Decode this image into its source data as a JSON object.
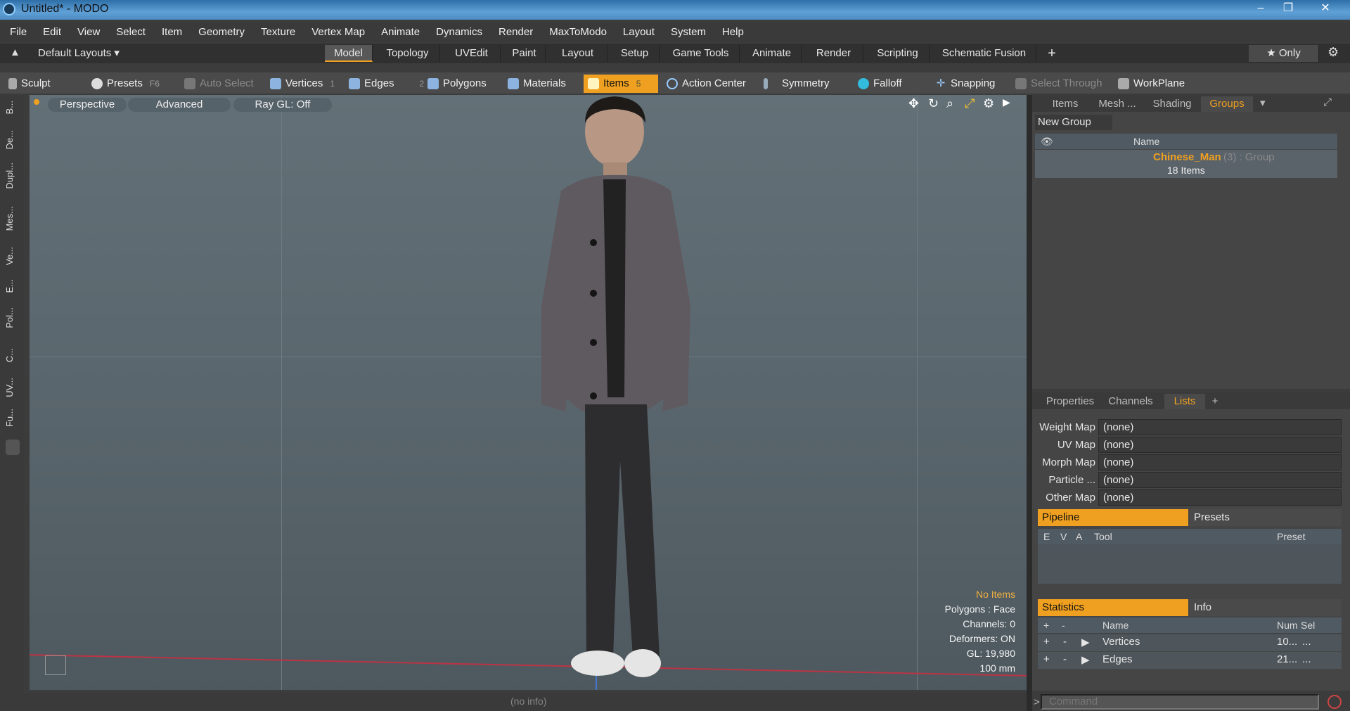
{
  "window": {
    "title": "Untitled* - MODO",
    "minimize": "‒",
    "maximize": "❐",
    "close": "✕"
  },
  "menu": [
    "File",
    "Edit",
    "View",
    "Select",
    "Item",
    "Geometry",
    "Texture",
    "Vertex Map",
    "Animate",
    "Dynamics",
    "Render",
    "MaxToModo",
    "Layout",
    "System",
    "Help"
  ],
  "layouts": {
    "label": "Default Layouts ▾"
  },
  "mode_tabs": [
    "Model",
    "Topology",
    "UVEdit",
    "Paint",
    "Layout",
    "Setup",
    "Game Tools",
    "Animate",
    "Render",
    "Scripting",
    "Schematic Fusion"
  ],
  "mode_tabs_active": "Model",
  "add_tab": "+",
  "only_label": "★ Only",
  "toolbar": {
    "sculpt": "Sculpt",
    "presets": "Presets",
    "presets_key": "F6",
    "auto_select": "Auto Select",
    "vertices": "Vertices",
    "vertices_num": "1",
    "edges": "Edges",
    "edges_num": "2",
    "polygons": "Polygons",
    "materials": "Materials",
    "items": "Items",
    "items_num": "5",
    "action_center": "Action Center",
    "symmetry": "Symmetry",
    "falloff": "Falloff",
    "snapping": "Snapping",
    "select_through": "Select Through",
    "workplane": "WorkPlane"
  },
  "left_strip": [
    "B...",
    "De...",
    "Dupl...",
    "Mes...",
    "Ve...",
    "E...",
    "Pol...",
    "C...",
    "UV...",
    "Fu..."
  ],
  "viewport": {
    "perspective": "Perspective",
    "advanced": "Advanced",
    "raygl": "Ray GL: Off",
    "status": "(no info)"
  },
  "hud": [
    "No Items",
    "Polygons : Face",
    "Channels: 0",
    "Deformers: ON",
    "GL: 19,980",
    "100 mm"
  ],
  "top_panel": {
    "tabs": [
      "Items",
      "Mesh ...",
      "Shading",
      "Groups"
    ],
    "active": "Groups",
    "new_group": "New Group",
    "name_header": "Name",
    "group_name": "Chinese_Man",
    "group_suffix": "(3) : Group",
    "group_count": "18 Items"
  },
  "lists_panel": {
    "tabs": [
      "Properties",
      "Channels",
      "Lists"
    ],
    "active": "Lists",
    "add": "+",
    "maps": [
      {
        "label": "Weight Map",
        "value": "(none)"
      },
      {
        "label": "UV Map",
        "value": "(none)"
      },
      {
        "label": "Morph Map",
        "value": "(none)"
      },
      {
        "label": "Particle ...",
        "value": "(none)"
      },
      {
        "label": "Other Map",
        "value": "(none)"
      }
    ],
    "pipeline": "Pipeline",
    "presets": "Presets",
    "pipe_cols": [
      "E",
      "V",
      "A",
      "Tool",
      "Preset"
    ]
  },
  "stats": {
    "tab1": "Statistics",
    "tab2": "Info",
    "cols": [
      "+",
      "-",
      "Name",
      "Num",
      "Sel"
    ],
    "rows": [
      {
        "name": "Vertices",
        "num": "10...",
        "sel": "..."
      },
      {
        "name": "Edges",
        "num": "21...",
        "sel": "..."
      }
    ]
  },
  "command": {
    "placeholder": "Command"
  }
}
